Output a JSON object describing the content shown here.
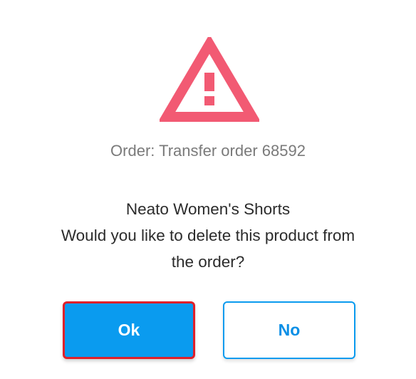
{
  "dialog": {
    "icon": "warning-triangle-icon",
    "icon_color": "#f25a73",
    "order_line": "Order: Transfer order 68592",
    "product_name": "Neato Women's Shorts",
    "question_line1": "Would you like to delete this product from",
    "question_line2": "the order?",
    "ok_label": "Ok",
    "no_label": "No",
    "primary_color": "#0a9bef",
    "focus_color": "#e0202a"
  }
}
